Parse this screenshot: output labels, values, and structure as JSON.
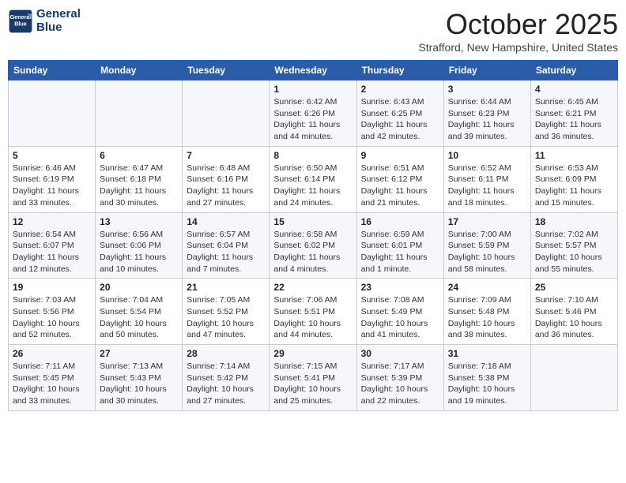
{
  "header": {
    "logo_line1": "General",
    "logo_line2": "Blue",
    "month": "October 2025",
    "location": "Strafford, New Hampshire, United States"
  },
  "weekdays": [
    "Sunday",
    "Monday",
    "Tuesday",
    "Wednesday",
    "Thursday",
    "Friday",
    "Saturday"
  ],
  "weeks": [
    [
      {
        "day": "",
        "sunrise": "",
        "sunset": "",
        "daylight": ""
      },
      {
        "day": "",
        "sunrise": "",
        "sunset": "",
        "daylight": ""
      },
      {
        "day": "",
        "sunrise": "",
        "sunset": "",
        "daylight": ""
      },
      {
        "day": "1",
        "sunrise": "Sunrise: 6:42 AM",
        "sunset": "Sunset: 6:26 PM",
        "daylight": "Daylight: 11 hours and 44 minutes."
      },
      {
        "day": "2",
        "sunrise": "Sunrise: 6:43 AM",
        "sunset": "Sunset: 6:25 PM",
        "daylight": "Daylight: 11 hours and 42 minutes."
      },
      {
        "day": "3",
        "sunrise": "Sunrise: 6:44 AM",
        "sunset": "Sunset: 6:23 PM",
        "daylight": "Daylight: 11 hours and 39 minutes."
      },
      {
        "day": "4",
        "sunrise": "Sunrise: 6:45 AM",
        "sunset": "Sunset: 6:21 PM",
        "daylight": "Daylight: 11 hours and 36 minutes."
      }
    ],
    [
      {
        "day": "5",
        "sunrise": "Sunrise: 6:46 AM",
        "sunset": "Sunset: 6:19 PM",
        "daylight": "Daylight: 11 hours and 33 minutes."
      },
      {
        "day": "6",
        "sunrise": "Sunrise: 6:47 AM",
        "sunset": "Sunset: 6:18 PM",
        "daylight": "Daylight: 11 hours and 30 minutes."
      },
      {
        "day": "7",
        "sunrise": "Sunrise: 6:48 AM",
        "sunset": "Sunset: 6:16 PM",
        "daylight": "Daylight: 11 hours and 27 minutes."
      },
      {
        "day": "8",
        "sunrise": "Sunrise: 6:50 AM",
        "sunset": "Sunset: 6:14 PM",
        "daylight": "Daylight: 11 hours and 24 minutes."
      },
      {
        "day": "9",
        "sunrise": "Sunrise: 6:51 AM",
        "sunset": "Sunset: 6:12 PM",
        "daylight": "Daylight: 11 hours and 21 minutes."
      },
      {
        "day": "10",
        "sunrise": "Sunrise: 6:52 AM",
        "sunset": "Sunset: 6:11 PM",
        "daylight": "Daylight: 11 hours and 18 minutes."
      },
      {
        "day": "11",
        "sunrise": "Sunrise: 6:53 AM",
        "sunset": "Sunset: 6:09 PM",
        "daylight": "Daylight: 11 hours and 15 minutes."
      }
    ],
    [
      {
        "day": "12",
        "sunrise": "Sunrise: 6:54 AM",
        "sunset": "Sunset: 6:07 PM",
        "daylight": "Daylight: 11 hours and 12 minutes."
      },
      {
        "day": "13",
        "sunrise": "Sunrise: 6:56 AM",
        "sunset": "Sunset: 6:06 PM",
        "daylight": "Daylight: 11 hours and 10 minutes."
      },
      {
        "day": "14",
        "sunrise": "Sunrise: 6:57 AM",
        "sunset": "Sunset: 6:04 PM",
        "daylight": "Daylight: 11 hours and 7 minutes."
      },
      {
        "day": "15",
        "sunrise": "Sunrise: 6:58 AM",
        "sunset": "Sunset: 6:02 PM",
        "daylight": "Daylight: 11 hours and 4 minutes."
      },
      {
        "day": "16",
        "sunrise": "Sunrise: 6:59 AM",
        "sunset": "Sunset: 6:01 PM",
        "daylight": "Daylight: 11 hours and 1 minute."
      },
      {
        "day": "17",
        "sunrise": "Sunrise: 7:00 AM",
        "sunset": "Sunset: 5:59 PM",
        "daylight": "Daylight: 10 hours and 58 minutes."
      },
      {
        "day": "18",
        "sunrise": "Sunrise: 7:02 AM",
        "sunset": "Sunset: 5:57 PM",
        "daylight": "Daylight: 10 hours and 55 minutes."
      }
    ],
    [
      {
        "day": "19",
        "sunrise": "Sunrise: 7:03 AM",
        "sunset": "Sunset: 5:56 PM",
        "daylight": "Daylight: 10 hours and 52 minutes."
      },
      {
        "day": "20",
        "sunrise": "Sunrise: 7:04 AM",
        "sunset": "Sunset: 5:54 PM",
        "daylight": "Daylight: 10 hours and 50 minutes."
      },
      {
        "day": "21",
        "sunrise": "Sunrise: 7:05 AM",
        "sunset": "Sunset: 5:52 PM",
        "daylight": "Daylight: 10 hours and 47 minutes."
      },
      {
        "day": "22",
        "sunrise": "Sunrise: 7:06 AM",
        "sunset": "Sunset: 5:51 PM",
        "daylight": "Daylight: 10 hours and 44 minutes."
      },
      {
        "day": "23",
        "sunrise": "Sunrise: 7:08 AM",
        "sunset": "Sunset: 5:49 PM",
        "daylight": "Daylight: 10 hours and 41 minutes."
      },
      {
        "day": "24",
        "sunrise": "Sunrise: 7:09 AM",
        "sunset": "Sunset: 5:48 PM",
        "daylight": "Daylight: 10 hours and 38 minutes."
      },
      {
        "day": "25",
        "sunrise": "Sunrise: 7:10 AM",
        "sunset": "Sunset: 5:46 PM",
        "daylight": "Daylight: 10 hours and 36 minutes."
      }
    ],
    [
      {
        "day": "26",
        "sunrise": "Sunrise: 7:11 AM",
        "sunset": "Sunset: 5:45 PM",
        "daylight": "Daylight: 10 hours and 33 minutes."
      },
      {
        "day": "27",
        "sunrise": "Sunrise: 7:13 AM",
        "sunset": "Sunset: 5:43 PM",
        "daylight": "Daylight: 10 hours and 30 minutes."
      },
      {
        "day": "28",
        "sunrise": "Sunrise: 7:14 AM",
        "sunset": "Sunset: 5:42 PM",
        "daylight": "Daylight: 10 hours and 27 minutes."
      },
      {
        "day": "29",
        "sunrise": "Sunrise: 7:15 AM",
        "sunset": "Sunset: 5:41 PM",
        "daylight": "Daylight: 10 hours and 25 minutes."
      },
      {
        "day": "30",
        "sunrise": "Sunrise: 7:17 AM",
        "sunset": "Sunset: 5:39 PM",
        "daylight": "Daylight: 10 hours and 22 minutes."
      },
      {
        "day": "31",
        "sunrise": "Sunrise: 7:18 AM",
        "sunset": "Sunset: 5:38 PM",
        "daylight": "Daylight: 10 hours and 19 minutes."
      },
      {
        "day": "",
        "sunrise": "",
        "sunset": "",
        "daylight": ""
      }
    ]
  ]
}
